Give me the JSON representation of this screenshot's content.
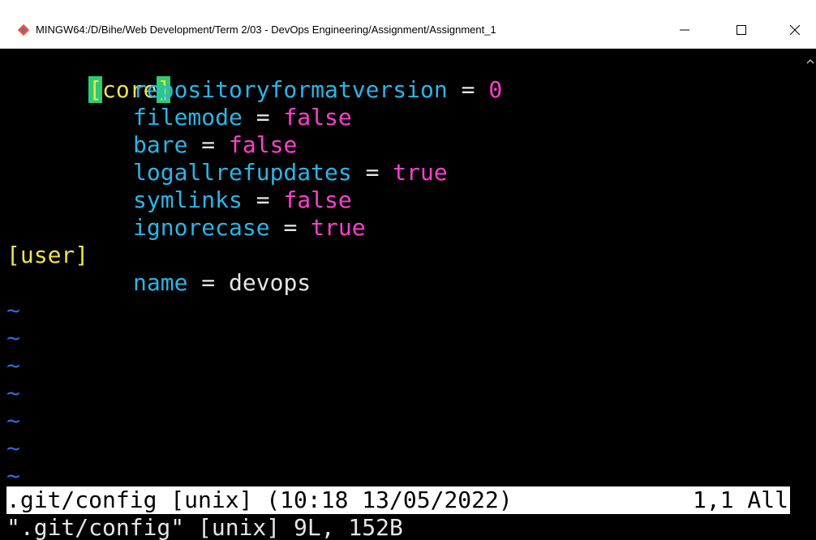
{
  "window": {
    "title": "MINGW64:/D/Bihe/Web Development/Term 2/03 - DevOps Engineering/Assignment/Assignment_1",
    "icon": "git-bash-icon",
    "controls": {
      "minimize": "minimize-icon",
      "maximize": "maximize-icon",
      "close": "close-icon"
    }
  },
  "editor": {
    "sections": [
      {
        "header": "core",
        "entries": [
          {
            "key": "repositoryformatversion",
            "op": "=",
            "value": "0"
          },
          {
            "key": "filemode",
            "op": "=",
            "value": "false"
          },
          {
            "key": "bare",
            "op": "=",
            "value": "false"
          },
          {
            "key": "logallrefupdates",
            "op": "=",
            "value": "true"
          },
          {
            "key": "symlinks",
            "op": "=",
            "value": "false"
          },
          {
            "key": "ignorecase",
            "op": "=",
            "value": "true"
          }
        ]
      },
      {
        "header": "user",
        "entries": [
          {
            "key": "name",
            "op": "=",
            "value": "devops"
          }
        ]
      }
    ],
    "bracket_open": "[",
    "bracket_close": "]",
    "tilde": "~",
    "empty_line_count": 7
  },
  "statusline": {
    "left": ".git/config [unix] (10:18 13/05/2022)",
    "right": "1,1 All"
  },
  "message": "\".git/config\" [unix] 9L, 152B",
  "colors": {
    "section_header": "#f0e24a",
    "key": "#29b6e8",
    "value_keyword": "#ff3fd0",
    "value_plain": "#e6e6e6",
    "bracket_highlight": "#2ecc71",
    "tilde": "#2d6fe0",
    "background": "#000000"
  }
}
